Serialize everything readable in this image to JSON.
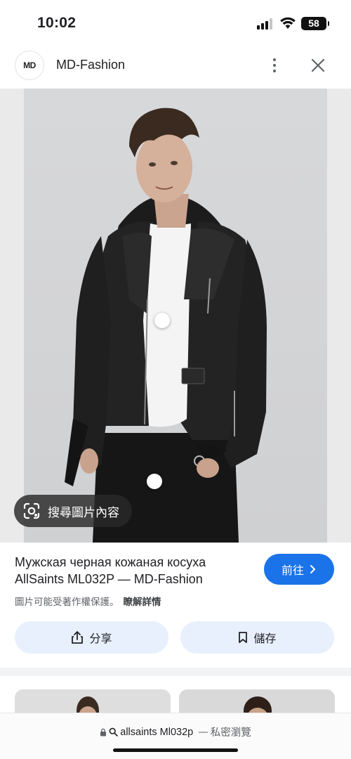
{
  "status_bar": {
    "time": "10:02",
    "battery": "58"
  },
  "header": {
    "logo_text": "MD",
    "site_name": "MD-Fashion"
  },
  "image_viewer": {
    "lens_label": "搜尋圖片內容"
  },
  "result": {
    "title": "Мужская черная кожаная косуха AllSaints ML032P — MD-Fashion",
    "visit_label": "前往",
    "copyright_notice": "圖片可能受著作權保護。",
    "learn_more": "瞭解詳情",
    "share_label": "分享",
    "save_label": "儲存"
  },
  "address_bar": {
    "query": "allsaints Ml032p",
    "separator": "—",
    "mode": "私密瀏覽"
  },
  "colors": {
    "accent": "#1a73e8",
    "chip_bg": "#e8f0fe"
  }
}
